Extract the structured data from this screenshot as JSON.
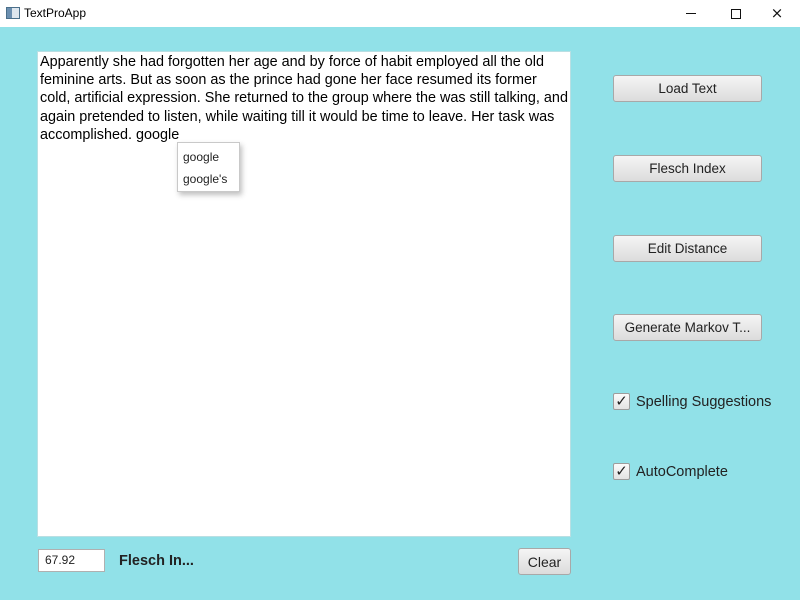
{
  "window": {
    "title": "TextProApp",
    "icon": "app-window-icon",
    "controls": {
      "minimize": "minimize-icon",
      "maximize": "maximize-icon",
      "close": "×"
    }
  },
  "editor": {
    "text": "Apparently she had forgotten her age and by force of habit employed all the old feminine arts. But as soon as the prince had gone her face resumed its former cold, artificial expression. She returned to the group where the was still talking, and again pretended to listen, while waiting till it would be time to leave. Her task was accomplished. google"
  },
  "autocomplete": {
    "items": [
      "google",
      "google's"
    ]
  },
  "sidebar": {
    "load_text": "Load Text",
    "flesch_index": "Flesch Index",
    "edit_distance": "Edit Distance",
    "generate_markov": "Generate Markov T...",
    "spelling_suggestions": {
      "label": "Spelling Suggestions",
      "checked": true
    },
    "autocomplete": {
      "label": "AutoComplete",
      "checked": true
    }
  },
  "footer": {
    "flesch_value": "67.92",
    "flesch_label": "Flesch In...",
    "clear": "Clear"
  },
  "colors": {
    "background": "#91e1e8",
    "editor_bg": "#ffffff"
  }
}
